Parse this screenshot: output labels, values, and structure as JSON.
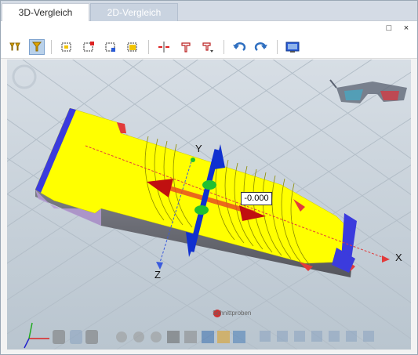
{
  "tabs": {
    "active": "3D-Vergleich",
    "inactive": "2D-Vergleich"
  },
  "window": {
    "maximize": "□",
    "close": "×"
  },
  "toolbar": {
    "icons": [
      "filter-icon",
      "filter-active-icon",
      "select-all-icon",
      "select-red-icon",
      "select-blue-icon",
      "select-yellow-icon",
      "split-icon",
      "cut-icon",
      "cut-arrow-icon",
      "undo-icon",
      "redo-icon",
      "screenshot-icon"
    ]
  },
  "viewport": {
    "measure_value": "-0.000",
    "axis_x": "X",
    "axis_y": "Y",
    "axis_z": "Z",
    "hint_label": "Schnittproben"
  },
  "colors": {
    "part": "#ffff00",
    "edge": "#3b3bdd",
    "accent": "#e23b3b",
    "grid_bg": "#c7d1da"
  }
}
